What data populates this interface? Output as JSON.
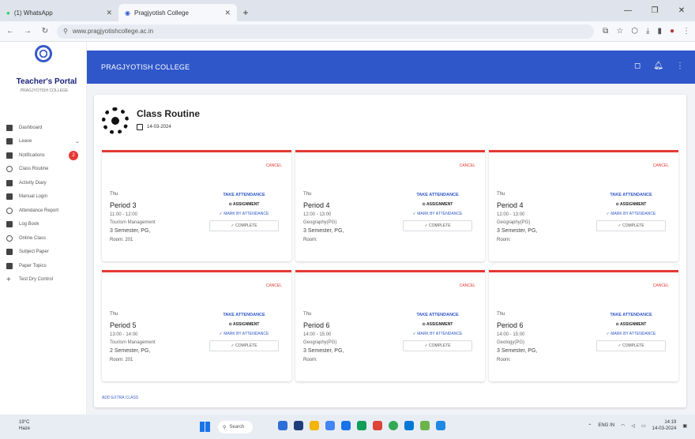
{
  "browser": {
    "tabs": [
      {
        "label": "(1) WhatsApp",
        "active": false
      },
      {
        "label": "Pragjyotish College",
        "active": true
      }
    ],
    "url": "www.pragjyotishcollege.ac.in"
  },
  "sidebar": {
    "portal_title": "Teacher's Portal",
    "portal_subtitle": "PRAGJYOTISH COLLEGE",
    "items": [
      {
        "label": "Dashboard",
        "icon": "dashboard-icon"
      },
      {
        "label": "Leave",
        "icon": "document-icon"
      },
      {
        "label": "Notifications",
        "icon": "bell-icon",
        "badge": "2"
      },
      {
        "label": "Class Routine",
        "icon": "clock-icon"
      },
      {
        "label": "Activity Diary",
        "icon": "book-icon"
      },
      {
        "label": "Manual Login",
        "icon": "grid-icon"
      },
      {
        "label": "Attendance Report",
        "icon": "clock-icon"
      },
      {
        "label": "Log Book",
        "icon": "book-icon"
      },
      {
        "label": "Online Class",
        "icon": "gear-icon"
      },
      {
        "label": "Subject Paper",
        "icon": "document-icon"
      },
      {
        "label": "Paper Topics",
        "icon": "list-icon"
      },
      {
        "label": "Test Dry Control",
        "icon": "add-icon"
      }
    ]
  },
  "appbar": {
    "title": "PRAGJYOTISH COLLEGE"
  },
  "routine": {
    "title": "Class Routine",
    "date": "14-03-2024",
    "cards": [
      {
        "cancel": "CANCEL",
        "day": "Thu",
        "period": "Period 3",
        "time": "11:00 - 12:00",
        "course": "Tourism Management",
        "semester": "3 Semester, PG,",
        "room": "Room: 201",
        "take": "TAKE ATTENDANCE",
        "assign": "ASSIGNMENT",
        "mark": "MARK BY ATTENDANCE",
        "complete": "COMPLETE"
      },
      {
        "cancel": "CANCEL",
        "day": "Thu",
        "period": "Period 4",
        "time": "12:00 - 13:00",
        "course": "Geography(PG)",
        "semester": "3 Semester, PG,",
        "room": "Room:",
        "take": "TAKE ATTENDANCE",
        "assign": "ASSIGNMENT",
        "mark": "MARK BY ATTENDANCE",
        "complete": "COMPLETE"
      },
      {
        "cancel": "CANCEL",
        "day": "Thu",
        "period": "Period 4",
        "time": "12:00 - 13:00",
        "course": "Geography(PG)",
        "semester": "3 Semester, PG,",
        "room": "Room:",
        "take": "TAKE ATTENDANCE",
        "assign": "ASSIGNMENT",
        "mark": "MARK BY ATTENDANCE",
        "complete": "COMPLETE"
      },
      {
        "cancel": "CANCEL",
        "day": "Thu",
        "period": "Period 5",
        "time": "13:00 - 14:00",
        "course": "Tourism Management",
        "semester": "2 Semester, PG,",
        "room": "Room: 201",
        "take": "TAKE ATTENDANCE",
        "assign": "ASSIGNMENT",
        "mark": "MARK BY ATTENDANCE",
        "complete": "COMPLETE"
      },
      {
        "cancel": "CANCEL",
        "day": "Thu",
        "period": "Period 6",
        "time": "14:00 - 15:00",
        "course": "Geography(PG)",
        "semester": "3 Semester, PG,",
        "room": "Room:",
        "take": "TAKE ATTENDANCE",
        "assign": "ASSIGNMENT",
        "mark": "MARK BY ATTENDANCE",
        "complete": "COMPLETE"
      },
      {
        "cancel": "CANCEL",
        "day": "Thu",
        "period": "Period 6",
        "time": "14:00 - 15:00",
        "course": "Geology(PG)",
        "semester": "3 Semester, PG,",
        "room": "Room:",
        "take": "TAKE ATTENDANCE",
        "assign": "ASSIGNMENT",
        "mark": "MARK BY ATTENDANCE",
        "complete": "COMPLETE"
      }
    ],
    "extra_link": "ADD EXTRA CLASS"
  },
  "taskbar": {
    "weather_temp": "19°C",
    "weather_text": "Haze",
    "search": "Search",
    "time": "14:19",
    "date": "14-03-2024",
    "lang": "ENG IN"
  },
  "colors": {
    "accent": "#2f57c9",
    "cancel": "#e53935"
  }
}
